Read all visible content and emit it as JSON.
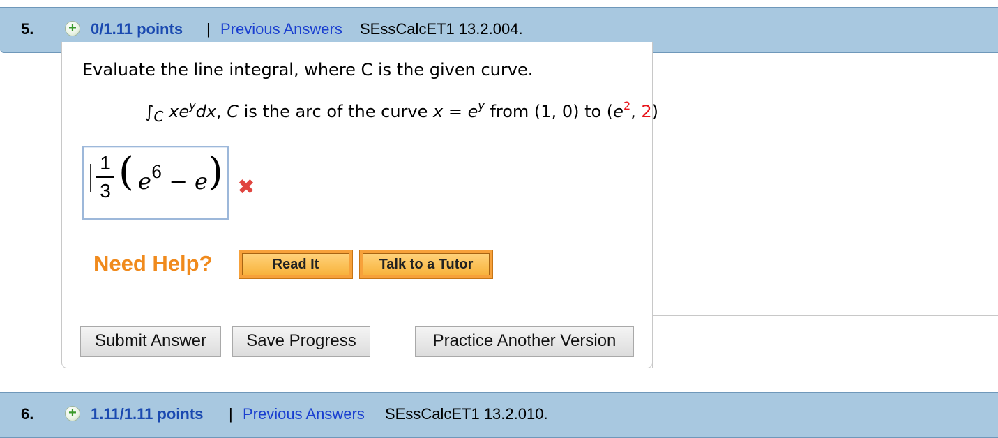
{
  "question5": {
    "number": "5.",
    "points": "0/1.11 points",
    "separator": "|",
    "previous_answers": "Previous Answers",
    "code": "SEssCalcET1 13.2.004.",
    "prompt": "Evaluate the line integral, where C is the given curve.",
    "integral": {
      "symbol": "∫",
      "subscript": "C",
      "integrand_a": "xe",
      "integrand_sup": "y",
      "integrand_b": "dx",
      "comma": ", ",
      "c_var": "C",
      "text1": " is the arc of the curve ",
      "x_var": "x",
      "eq": " = ",
      "e_var": "e",
      "e_sup": "y",
      "from_text": " from (1, 0) to (",
      "e_end": "e",
      "e_end_sup": "2",
      "comma2": ", ",
      "end_y": "2",
      "close": ")"
    },
    "answer": {
      "numerator": "1",
      "denominator": "3",
      "paren_open": "(",
      "base": "e",
      "exponent": "6",
      "minus": "−",
      "tail": "e",
      "paren_close": ")"
    },
    "wrong_mark": "✖",
    "need_help": "Need Help?",
    "read_it": "Read It",
    "talk_to_tutor": "Talk to a Tutor",
    "submit": "Submit Answer",
    "save": "Save Progress",
    "practice": "Practice Another Version"
  },
  "question6": {
    "number": "6.",
    "points": "1.11/1.11 points",
    "separator": "|",
    "previous_answers": "Previous Answers",
    "code": "SEssCalcET1 13.2.010."
  },
  "colors": {
    "header_bg": "#a8c8e0",
    "points_blue": "#1a49b0",
    "link_blue": "#1a3fd0",
    "need_help_orange": "#f08a1c",
    "error_red": "#e0453f",
    "highlight_red": "#e8141a"
  }
}
